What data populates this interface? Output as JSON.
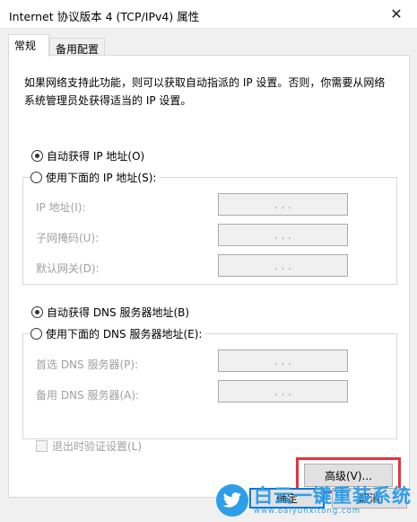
{
  "window": {
    "title": "Internet 协议版本 4 (TCP/IPv4) 属性",
    "close_glyph": "✕"
  },
  "tabs": [
    {
      "label": "常规"
    },
    {
      "label": "备用配置"
    }
  ],
  "general": {
    "description": "如果网络支持此功能，则可以获取自动指派的 IP 设置。否则，你需要从网络系统管理员处获得适当的 IP 设置。",
    "ip": {
      "auto_label": "自动获得 IP 地址(O)",
      "manual_label": "使用下面的 IP 地址(S):",
      "selected": "auto",
      "fields": [
        {
          "label": "IP 地址(I):",
          "value": ". . ."
        },
        {
          "label": "子网掩码(U):",
          "value": ". . ."
        },
        {
          "label": "默认网关(D):",
          "value": ". . ."
        }
      ]
    },
    "dns": {
      "auto_label": "自动获得 DNS 服务器地址(B)",
      "manual_label": "使用下面的 DNS 服务器地址(E):",
      "selected": "auto",
      "fields": [
        {
          "label": "首选 DNS 服务器(P):",
          "value": ". . ."
        },
        {
          "label": "备用 DNS 服务器(A):",
          "value": ". . ."
        }
      ]
    },
    "validate_label": "退出时验证设置(L)",
    "advanced_label": "高级(V)..."
  },
  "footer": {
    "ok_label": "确定",
    "cancel_label": "取消"
  },
  "watermark": {
    "name": "白云一键重装系统",
    "url": "www.baiyunxitong.com",
    "icon": "twitter-bird-icon"
  },
  "colors": {
    "highlight": "#e8333f",
    "accent": "#0078d7",
    "watermark": "#2f9ee8"
  }
}
